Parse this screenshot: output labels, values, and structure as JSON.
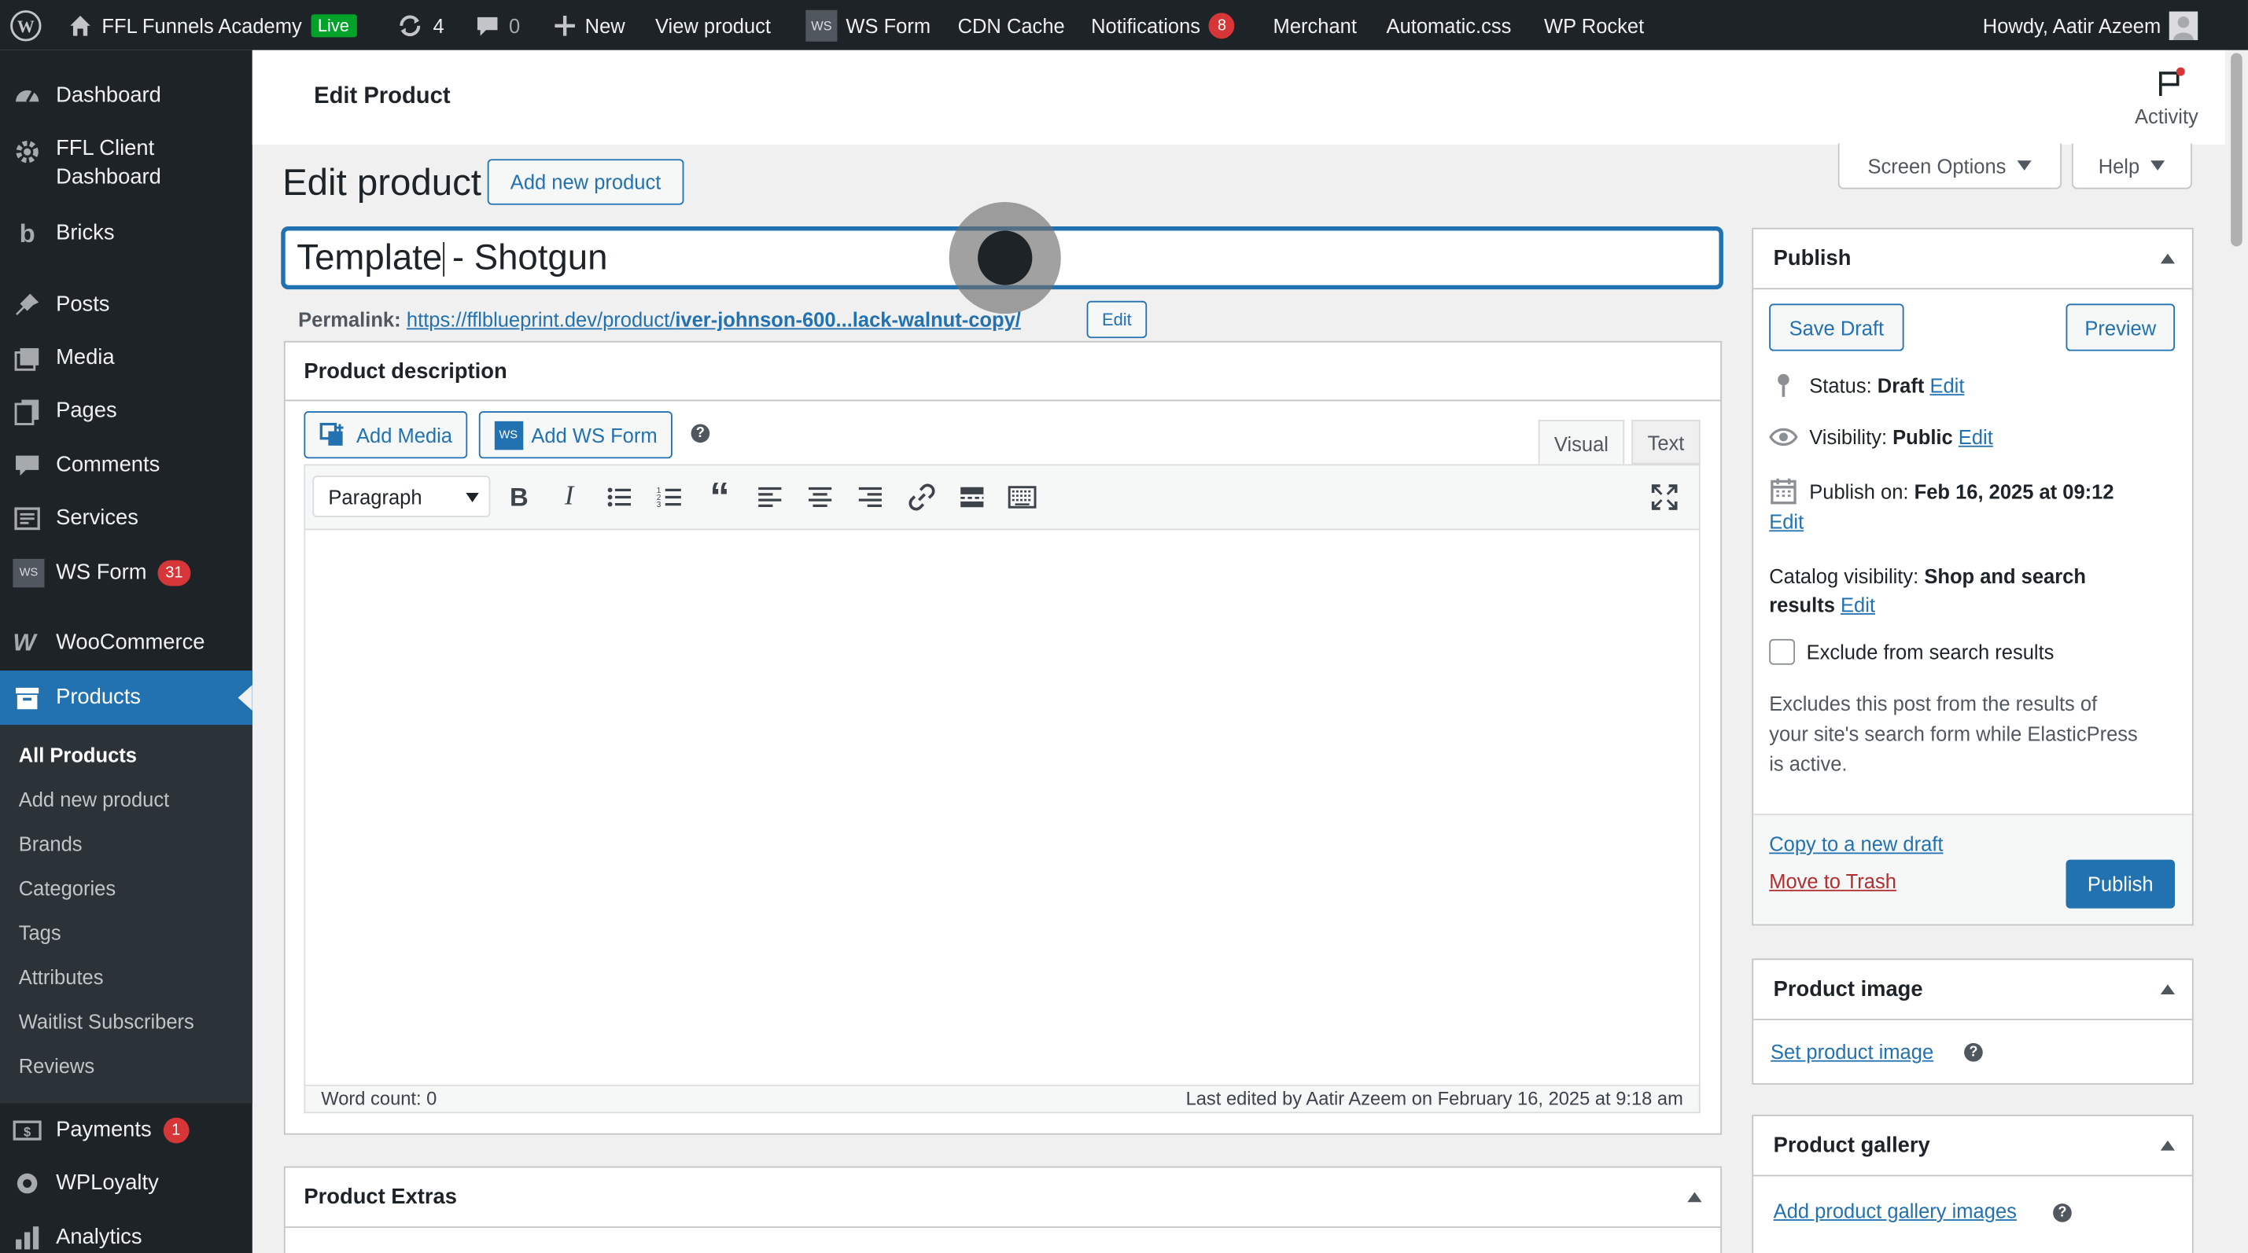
{
  "admin_bar": {
    "site_name": "FFL Funnels Academy",
    "live_badge": "Live",
    "updates_count": "4",
    "comments_count": "0",
    "new_label": "New",
    "view_product": "View product",
    "ws_form": "WS Form",
    "cdn_cache": "CDN Cache",
    "notifications": "Notifications",
    "notifications_count": "8",
    "merchant": "Merchant",
    "automatic_css": "Automatic.css",
    "wp_rocket": "WP Rocket",
    "howdy": "Howdy, Aatir Azeem"
  },
  "sidebar": {
    "dashboard": "Dashboard",
    "ffl_client_line1": "FFL Client",
    "ffl_client_line2": "Dashboard",
    "bricks": "Bricks",
    "posts": "Posts",
    "media": "Media",
    "pages": "Pages",
    "comments": "Comments",
    "services": "Services",
    "ws_form": "WS Form",
    "ws_form_count": "31",
    "woocommerce": "WooCommerce",
    "products": "Products",
    "submenu": [
      "All Products",
      "Add new product",
      "Brands",
      "Categories",
      "Tags",
      "Attributes",
      "Waitlist Subscribers",
      "Reviews"
    ],
    "payments": "Payments",
    "payments_count": "1",
    "wployalty": "WPLoyalty",
    "analytics": "Analytics"
  },
  "header": {
    "page_heading": "Edit Product",
    "activity": "Activity",
    "screen_options": "Screen Options",
    "help": "Help"
  },
  "main": {
    "title": "Edit product",
    "add_new": "Add new product",
    "product_title_value": "Template - Shotgun",
    "permalink_label": "Permalink:",
    "permalink_base": "https://fflblueprint.dev/product/",
    "permalink_slug": "iver-johnson-600...lack-walnut-copy/",
    "permalink_edit": "Edit",
    "description_heading": "Product description",
    "add_media": "Add Media",
    "add_ws_form": "Add WS Form",
    "tab_visual": "Visual",
    "tab_text": "Text",
    "format_select": "Paragraph",
    "word_count": "Word count: 0",
    "last_edited": "Last edited by Aatir Azeem on February 16, 2025 at 9:18 am",
    "product_extras": "Product Extras"
  },
  "publish": {
    "heading": "Publish",
    "save_draft": "Save Draft",
    "preview": "Preview",
    "status_label": "Status:",
    "status_value": "Draft",
    "visibility_label": "Visibility:",
    "visibility_value": "Public",
    "publish_on_label": "Publish on:",
    "publish_on_value": "Feb 16, 2025 at 09:12",
    "edit": "Edit",
    "catalog_label": "Catalog visibility:",
    "catalog_value_1": "Shop and search",
    "catalog_value_2": "results",
    "exclude_label": "Exclude from search results",
    "exclude_desc_1": "Excludes this post from the results of",
    "exclude_desc_2": "your site's search form while ElasticPress",
    "exclude_desc_3": "is active.",
    "copy_draft": "Copy to a new draft",
    "move_trash": "Move to Trash",
    "publish_btn": "Publish"
  },
  "product_image": {
    "heading": "Product image",
    "set_image": "Set product image"
  },
  "product_gallery": {
    "heading": "Product gallery",
    "add_images": "Add product gallery images"
  },
  "colors": {
    "admin_bg": "#1d2327",
    "accent": "#2271b1",
    "badge_red": "#d63638",
    "live_green": "#00a32a",
    "trash_red": "#b32d2e"
  }
}
